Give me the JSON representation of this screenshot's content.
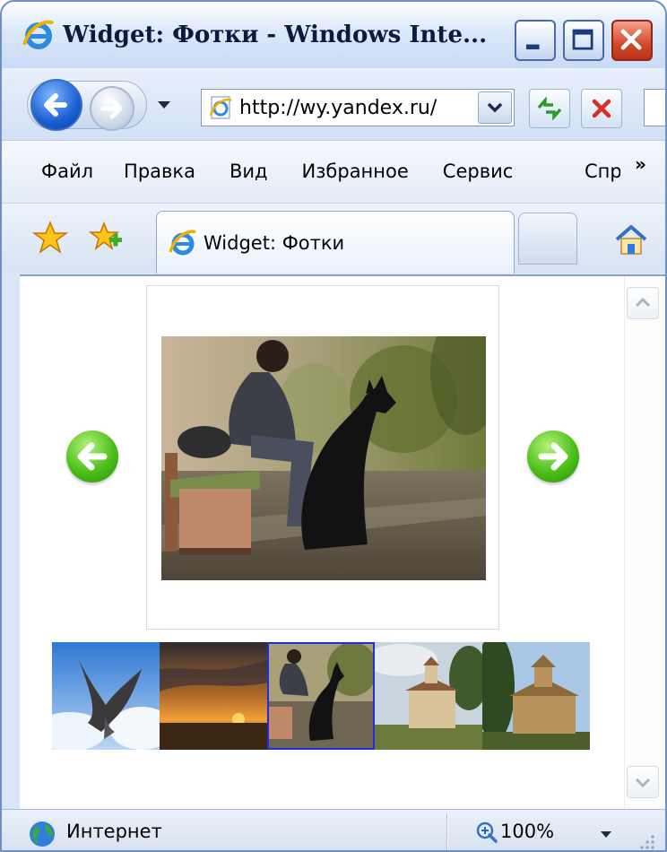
{
  "window": {
    "title": "Widget: Фотки - Windows Inte..."
  },
  "navigation": {
    "address": "http://wy.yandex.ru/",
    "back_icon": "back-arrow-icon",
    "forward_icon": "forward-arrow-icon",
    "refresh_icon": "refresh-icon",
    "stop_icon": "stop-icon"
  },
  "menu": {
    "items": [
      "Файл",
      "Правка",
      "Вид",
      "Избранное",
      "Сервис"
    ],
    "clipped_item": "Спр",
    "overflow_chevron": "»"
  },
  "tab": {
    "label": "Widget: Фотки"
  },
  "gallery": {
    "thumbnails": [
      {
        "subject": "pigeon",
        "selected": false
      },
      {
        "subject": "sunset",
        "selected": false
      },
      {
        "subject": "man-with-dog",
        "selected": true
      },
      {
        "subject": "church",
        "selected": false
      },
      {
        "subject": "chapel",
        "selected": false
      }
    ],
    "colors": {
      "arrow_green": "#4cbf1a",
      "selected_border": "#1f2fe0"
    }
  },
  "status": {
    "zone": "Интернет",
    "zoom": "100%"
  }
}
